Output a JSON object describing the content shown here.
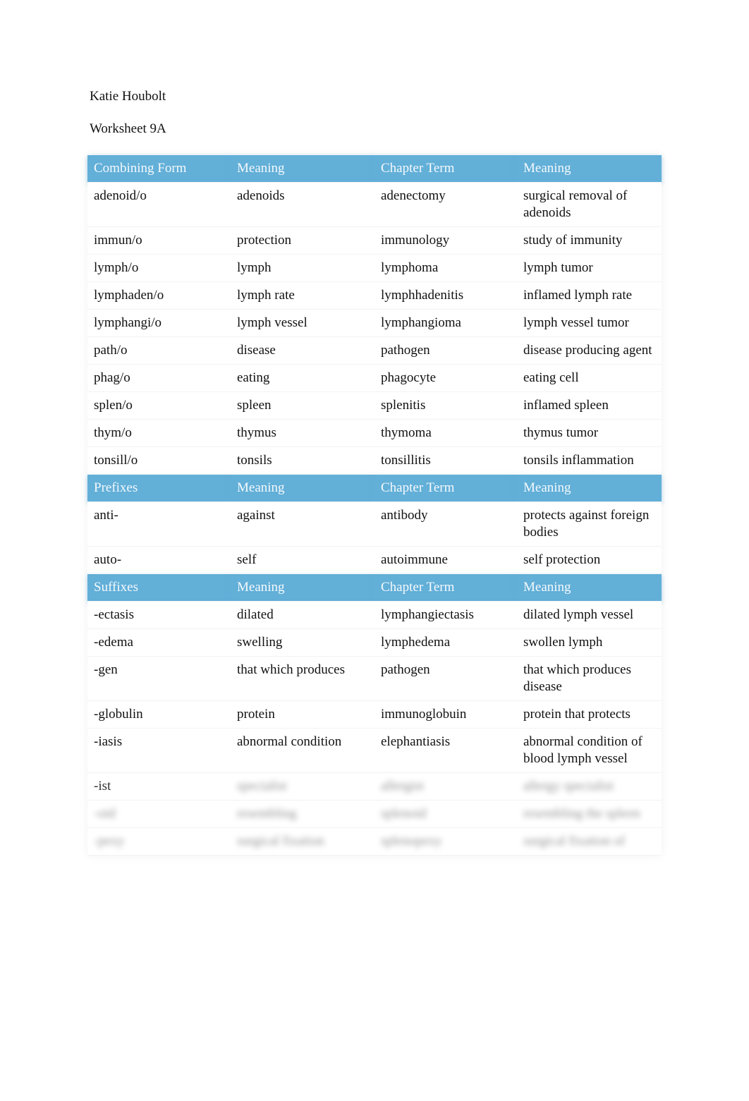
{
  "document": {
    "author": "Katie Houbolt",
    "title": "Worksheet 9A"
  },
  "sections": [
    {
      "header": [
        "Combining Form",
        "Meaning",
        "Chapter Term",
        "Meaning"
      ],
      "rows": [
        [
          "adenoid/o",
          "adenoids",
          "adenectomy",
          "surgical removal of adenoids"
        ],
        [
          "immun/o",
          "protection",
          "immunology",
          "study of immunity"
        ],
        [
          "lymph/o",
          "lymph",
          "lymphoma",
          "lymph tumor"
        ],
        [
          "lymphaden/o",
          "lymph rate",
          "lymphhadenitis",
          "inflamed lymph rate"
        ],
        [
          "lymphangi/o",
          "lymph vessel",
          "lymphangioma",
          "lymph vessel tumor"
        ],
        [
          "path/o",
          "disease",
          "pathogen",
          "disease producing agent"
        ],
        [
          "phag/o",
          "eating",
          "phagocyte",
          "eating cell"
        ],
        [
          "splen/o",
          "spleen",
          "splenitis",
          "inflamed spleen"
        ],
        [
          "thym/o",
          "thymus",
          "thymoma",
          "thymus tumor"
        ],
        [
          "tonsill/o",
          "tonsils",
          "tonsillitis",
          "tonsils inflammation"
        ]
      ]
    },
    {
      "header": [
        "Prefixes",
        "Meaning",
        "Chapter Term",
        "Meaning"
      ],
      "rows": [
        [
          "anti-",
          "against",
          "antibody",
          "protects against foreign bodies"
        ],
        [
          "auto-",
          "self",
          "autoimmune",
          "self protection"
        ]
      ]
    },
    {
      "header": [
        "Suffixes",
        "Meaning",
        "Chapter Term",
        "Meaning"
      ],
      "rows": [
        [
          "-ectasis",
          "dilated",
          "lymphangiectasis",
          "dilated lymph vessel"
        ],
        [
          "-edema",
          "swelling",
          "lymphedema",
          "swollen lymph"
        ],
        [
          "-gen",
          "that which produces",
          "pathogen",
          "that which produces disease"
        ],
        [
          "-globulin",
          "protein",
          "immunoglobuin",
          "protein that protects"
        ],
        [
          "-iasis",
          "abnormal condition",
          "elephantiasis",
          "abnormal condition of blood lymph vessel"
        ],
        [
          "-ist",
          "specialist",
          "allergist",
          "allergy specialist"
        ]
      ],
      "blurred_rows": [
        [
          "-oid",
          "resembling",
          "splenoid",
          "resembling the spleen"
        ],
        [
          "-pexy",
          "surgical fixation",
          "splenopexy",
          "surgical fixation of"
        ]
      ]
    }
  ],
  "colors": {
    "header_bg": "#62afd8",
    "header_text": "#f4f9fc"
  }
}
